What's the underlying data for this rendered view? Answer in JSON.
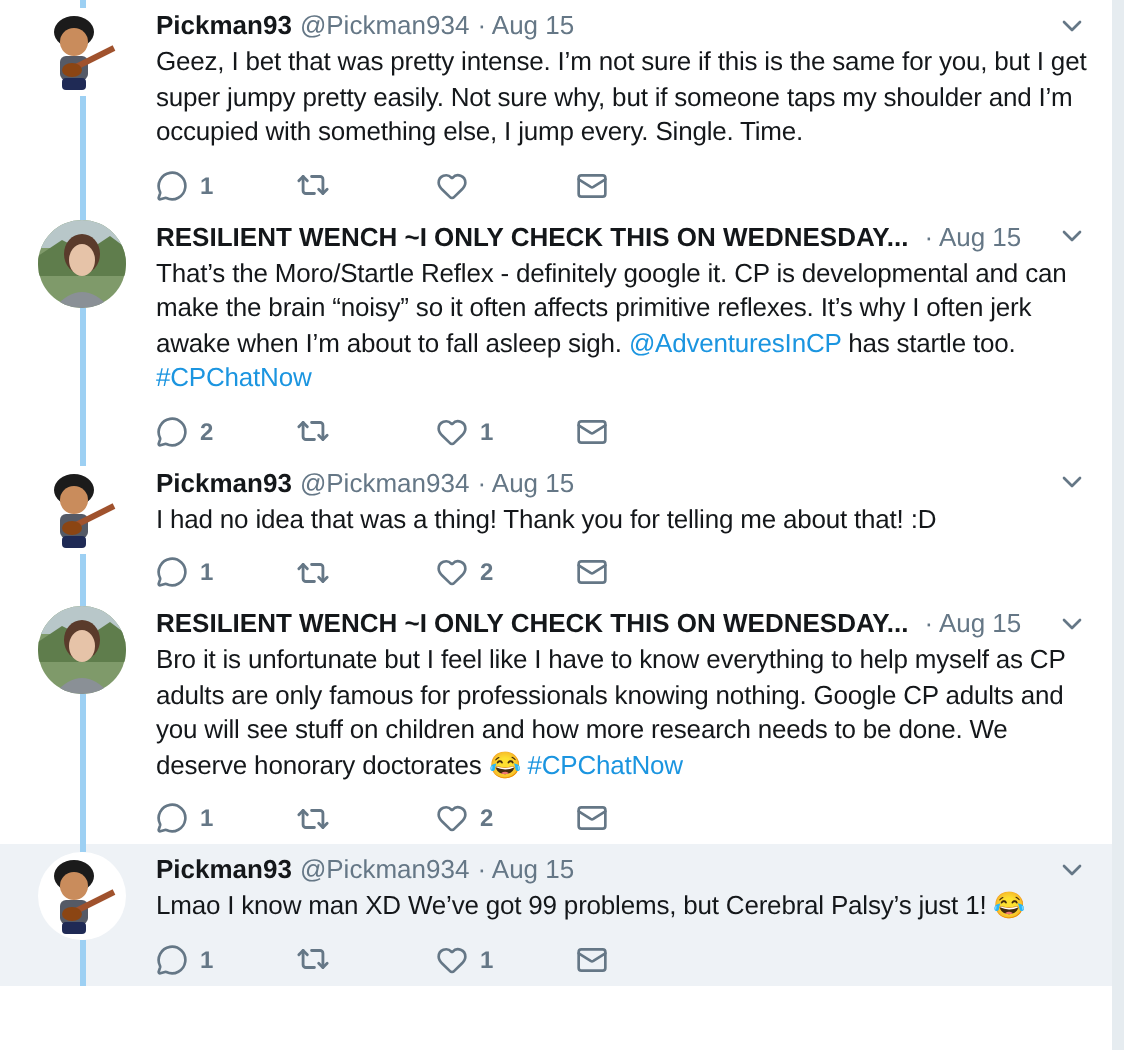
{
  "tweets": [
    {
      "avatar": {
        "kind": "cartoon"
      },
      "name": "Pickman93",
      "handle": "@Pickman934",
      "date": "· Aug 15",
      "highlighted": false,
      "text": [
        {
          "kind": "text",
          "value": "Geez, I bet that was pretty intense. I’m not sure if this is the same for you, but I get super jumpy pretty easily. Not sure why, but if someone taps my shoulder and I’m occupied with something else, I jump every. Single. Time."
        }
      ],
      "replies": "1"
    },
    {
      "avatar": {
        "kind": "picture"
      },
      "name": "RESILIENT WENCH ~I ONLY CHECK THIS ON WEDNESDAY...",
      "date": "· Aug 15",
      "highlighted": false,
      "text": [
        {
          "kind": "text",
          "value": "That’s the Moro/Startle Reflex - definitely google it. CP is developmental and can make the brain “noisy” so it often affects primitive reflexes. It’s why I often jerk awake when I’m about to fall asleep sigh. "
        },
        {
          "kind": "link",
          "value": "@AdventuresInCP"
        },
        {
          "kind": "text",
          "value": " has startle too. "
        },
        {
          "kind": "link",
          "value": "#CPChatNow"
        }
      ],
      "replies": "2",
      "likes": "1"
    },
    {
      "avatar": {
        "kind": "cartoon"
      },
      "name": "Pickman93",
      "handle": "@Pickman934",
      "date": "· Aug 15",
      "highlighted": false,
      "text": [
        {
          "kind": "text",
          "value": "I had no idea that was a thing! Thank you for telling me about that! :D"
        }
      ],
      "replies": "1",
      "likes": "2"
    },
    {
      "avatar": {
        "kind": "picture"
      },
      "name": "RESILIENT WENCH ~I ONLY CHECK THIS ON WEDNESDAY...",
      "date": "· Aug 15",
      "highlighted": false,
      "text": [
        {
          "kind": "text",
          "value": "Bro it is unfortunate but I feel like I have to know everything to help myself as CP adults are only famous for professionals knowing nothing. Google CP adults and you will see stuff on children and how more research needs to be done. We deserve honorary doctorates 😂 "
        },
        {
          "kind": "link",
          "value": "#CPChatNow"
        }
      ],
      "replies": "1",
      "likes": "2"
    },
    {
      "avatar": {
        "kind": "cartoon"
      },
      "name": "Pickman93",
      "handle": "@Pickman934",
      "date": "· Aug 15",
      "highlighted": true,
      "text": [
        {
          "kind": "text",
          "value": "Lmao I know man XD We’ve got 99 problems, but Cerebral Palsy’s just 1! 😂"
        }
      ],
      "replies": "1",
      "likes": "1"
    }
  ]
}
